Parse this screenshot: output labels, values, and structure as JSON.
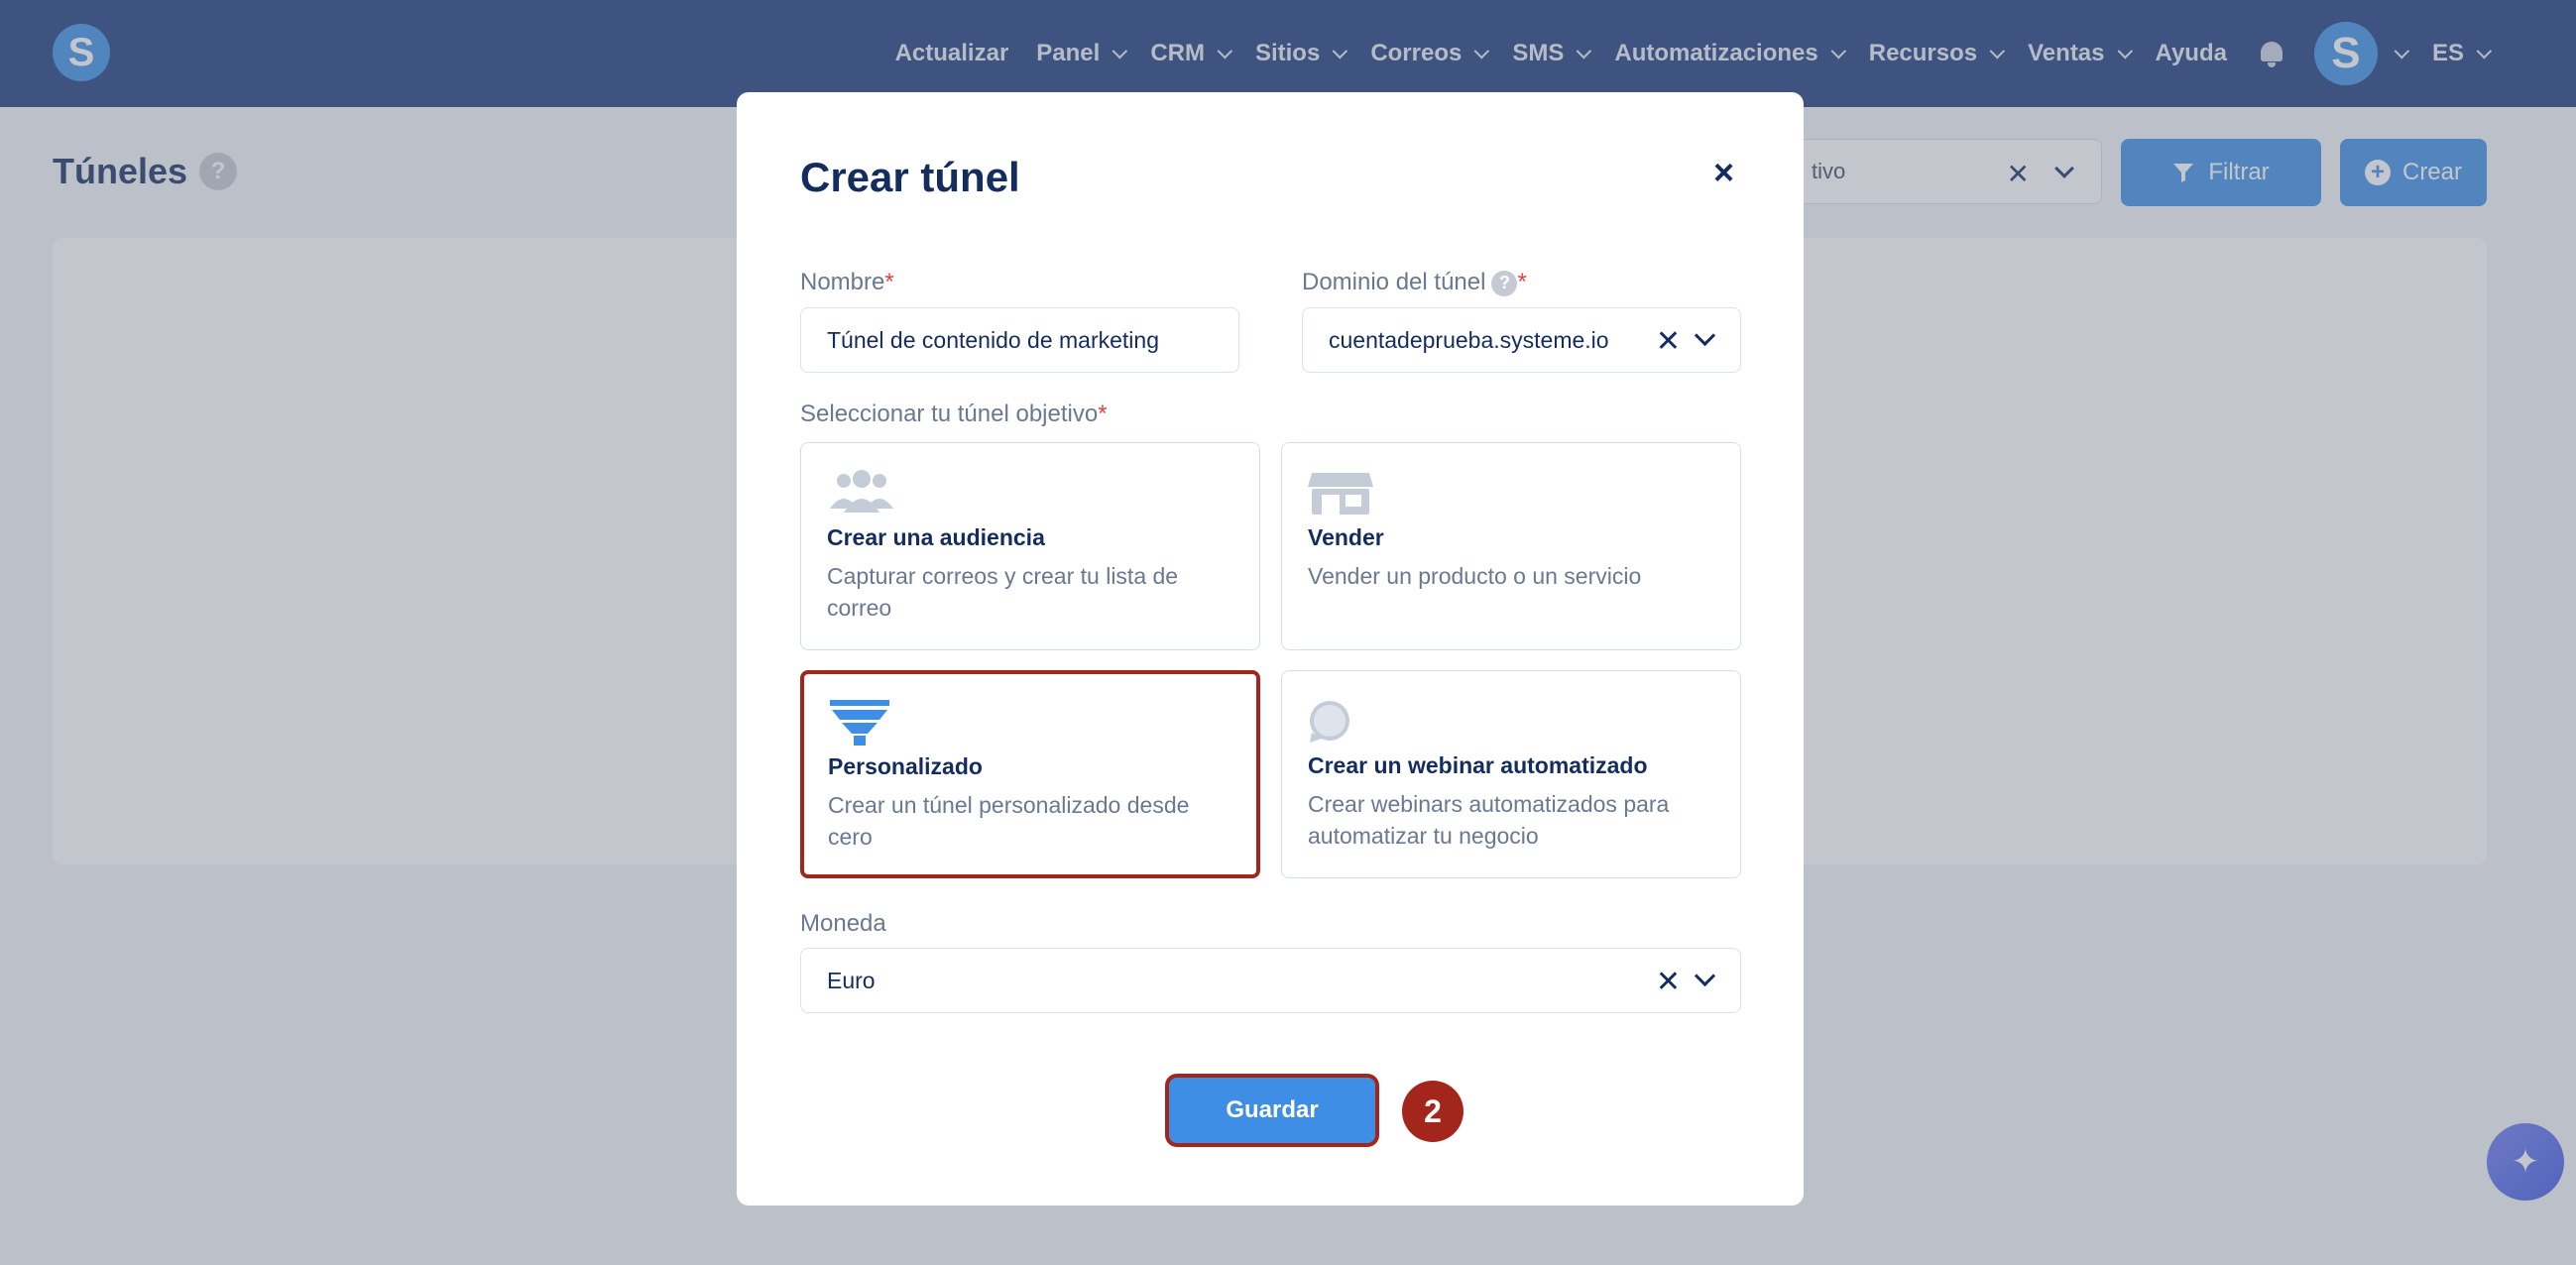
{
  "nav": {
    "logo_letter": "S",
    "items": [
      {
        "label": "Actualizar",
        "dropdown": false
      },
      {
        "label": "Panel",
        "dropdown": true
      },
      {
        "label": "CRM",
        "dropdown": true
      },
      {
        "label": "Sitios",
        "dropdown": true
      },
      {
        "label": "Correos",
        "dropdown": true
      },
      {
        "label": "SMS",
        "dropdown": true
      },
      {
        "label": "Automatizaciones",
        "dropdown": true
      },
      {
        "label": "Recursos",
        "dropdown": true
      },
      {
        "label": "Ventas",
        "dropdown": true
      },
      {
        "label": "Ayuda",
        "dropdown": false
      }
    ],
    "avatar_letter": "S",
    "language": "ES"
  },
  "page": {
    "title": "Túneles",
    "help": "?",
    "status_filter_value": "tivo",
    "filter_button": "Filtrar",
    "create_button": "Crear"
  },
  "modal": {
    "title": "Crear túnel",
    "close": "×",
    "name_label": "Nombre",
    "name_value": "Túnel de contenido de marketing",
    "domain_label": "Dominio del túnel",
    "domain_help": "?",
    "domain_value": "cuentadeprueba.systeme.io",
    "goal_label": "Seleccionar tu túnel objetivo",
    "required_mark": "*",
    "goals": [
      {
        "icon": "audience-icon",
        "title": "Crear una audiencia",
        "desc": "Capturar correos y crear tu lista de correo",
        "selected": false
      },
      {
        "icon": "store-icon",
        "title": "Vender",
        "desc": "Vender un producto o un servicio",
        "selected": false
      },
      {
        "icon": "funnel-icon",
        "title": "Personalizado",
        "desc": "Crear un túnel personalizado desde cero",
        "selected": true
      },
      {
        "icon": "webinar-icon",
        "title": "Crear un webinar automatizado",
        "desc": "Crear webinars automatizados para automatizar tu negocio",
        "selected": false
      }
    ],
    "currency_label": "Moneda",
    "currency_value": "Euro",
    "save_button": "Guardar",
    "step_badge": "2"
  },
  "colors": {
    "nav_bg": "#1b3a7a",
    "primary": "#3d8ee4",
    "highlight": "#a3261c",
    "text_dark": "#142d5e",
    "text_muted": "#6a7891"
  }
}
